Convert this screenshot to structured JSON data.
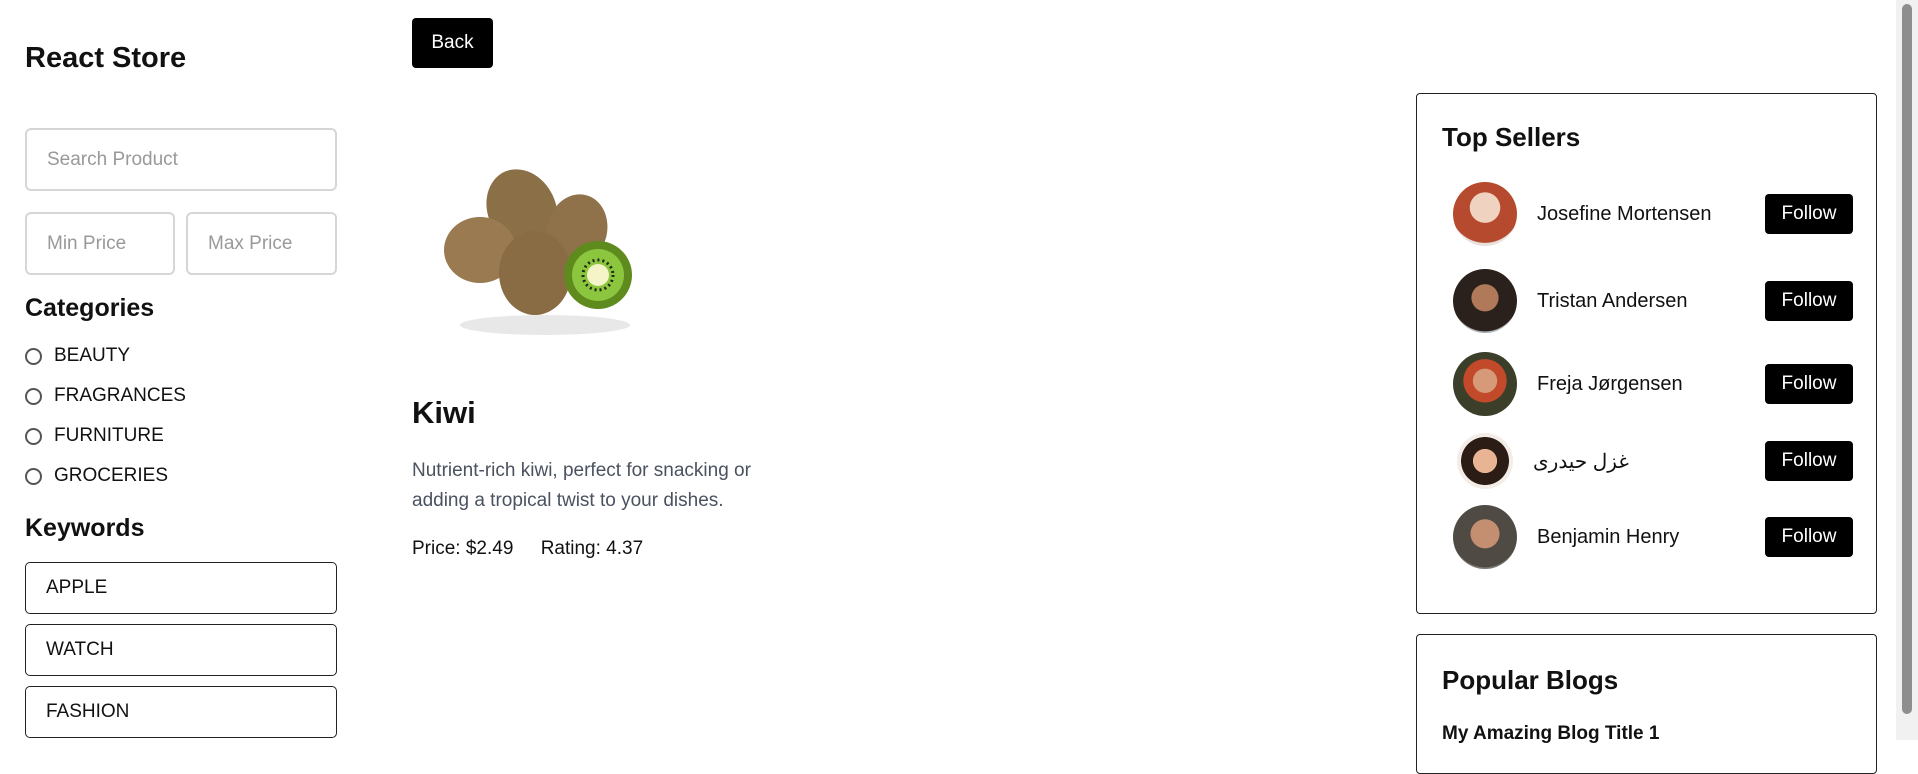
{
  "sidebar": {
    "brand": "React Store",
    "search_placeholder": "Search Product",
    "min_price_placeholder": "Min Price",
    "max_price_placeholder": "Max Price",
    "categories_heading": "Categories",
    "categories": [
      "BEAUTY",
      "FRAGRANCES",
      "FURNITURE",
      "GROCERIES"
    ],
    "keywords_heading": "Keywords",
    "keywords": [
      "APPLE",
      "WATCH",
      "FASHION"
    ]
  },
  "main": {
    "back_label": "Back",
    "product": {
      "title": "Kiwi",
      "description": "Nutrient-rich kiwi, perfect for snacking or adding a tropical twist to your dishes.",
      "price": "Price: $2.49",
      "rating": "Rating: 4.37"
    }
  },
  "top_sellers": {
    "heading": "Top Sellers",
    "follow_label": "Follow",
    "sellers": [
      {
        "name": "Josefine Mortensen",
        "avatar_color": "#c98a6e"
      },
      {
        "name": "Tristan Andersen",
        "avatar_color": "#4a3b33"
      },
      {
        "name": "Freja Jørgensen",
        "avatar_color": "#6b4a3a"
      },
      {
        "name": "غزل حیدری",
        "avatar_color": "#d7a58a"
      },
      {
        "name": "Benjamin Henry",
        "avatar_color": "#5d5a55"
      }
    ]
  },
  "popular_blogs": {
    "heading": "Popular Blogs",
    "items": [
      "My Amazing Blog Title 1"
    ]
  },
  "colors": {
    "button_bg": "#000000",
    "text": "#111111",
    "muted": "#4a5260"
  }
}
